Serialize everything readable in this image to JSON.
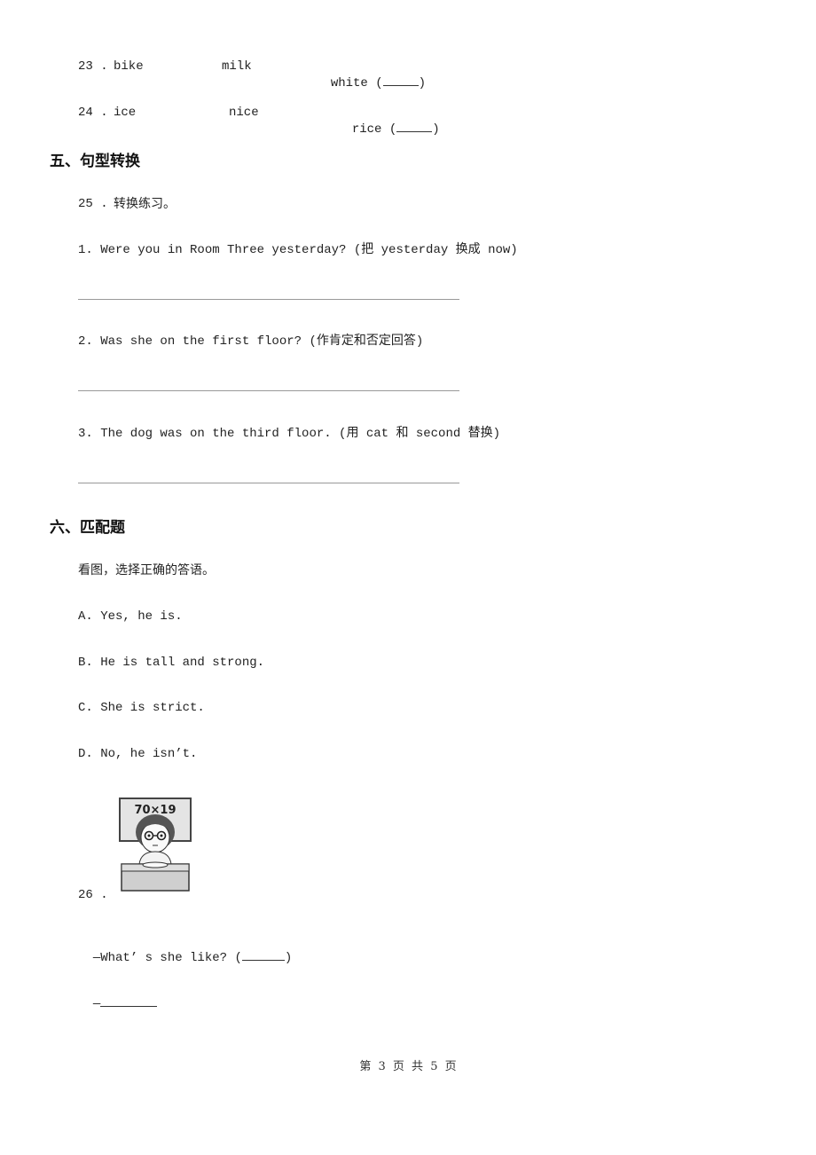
{
  "items": {
    "q23": {
      "num": "23 .",
      "w1": "bike",
      "w2": "milk",
      "w3": "white (",
      "close": ")"
    },
    "q24": {
      "num": "24 .",
      "w1": "ice",
      "w2": "nice",
      "w3": "rice (",
      "close": ")"
    }
  },
  "section5": {
    "title": "五、句型转换",
    "q25": {
      "num": "25 .",
      "text": "转换练习。"
    },
    "subs": [
      "1. Were you in Room Three yesterday? (把 yesterday 换成 now)",
      "2. Was she on the first floor? (作肯定和否定回答)",
      "3. The dog was on the third floor. (用 cat 和 second 替换)"
    ]
  },
  "section6": {
    "title": "六、匹配题",
    "instruction": "看图，选择正确的答语。",
    "options": [
      "A. Yes, he is.",
      "B. He is tall and strong.",
      "C. She is strict.",
      "D. No, he isn’t."
    ],
    "q26": {
      "num": "26 .",
      "board_text": "70×19",
      "question": "—What’ s she like? (",
      "question_close": ")",
      "answer_prefix": "—"
    }
  },
  "footer": "第 3 页 共 5 页"
}
